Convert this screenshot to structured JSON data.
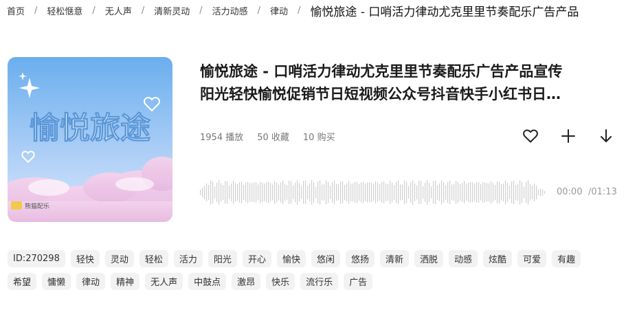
{
  "breadcrumb": {
    "items": [
      "首页",
      "轻松惬意",
      "无人声",
      "清新灵动",
      "活力动感",
      "律动"
    ],
    "separator": "/",
    "current": "愉悦旅途 - 口哨活力律动尤克里里节奏配乐广告产品"
  },
  "cover": {
    "text": "愉悦旅途",
    "badge_text": "熊猫配乐"
  },
  "track": {
    "title_line1": "愉悦旅途 - 口哨活力律动尤克里里节奏配乐广告产品宣传",
    "title_line2": "阳光轻快愉悦促销节日短视频公众号抖音快手小红书日…",
    "plays": "1954 播放",
    "favorites": "50 收藏",
    "purchases": "10 购买"
  },
  "actions": {
    "favorite_icon": "heart-icon",
    "add_icon": "plus-icon",
    "download_icon": "download-arrow-icon"
  },
  "player": {
    "current_time": "00:00",
    "total_time": "/01:13",
    "progress": 0
  },
  "tags": [
    "ID:270298",
    "轻快",
    "灵动",
    "轻松",
    "活力",
    "阳光",
    "开心",
    "愉快",
    "悠闲",
    "悠扬",
    "清新",
    "洒脱",
    "动感",
    "炫酷",
    "可爱",
    "有趣",
    "希望",
    "慵懒",
    "律动",
    "精神",
    "无人声",
    "中鼓点",
    "激昂",
    "快乐",
    "流行乐",
    "广告"
  ],
  "colors": {
    "sky_top": "#6fb0ee",
    "sky_bottom": "#cfe2fb",
    "cloud_pink": "#f4c3e3",
    "waveform": "#cfcfcf"
  }
}
